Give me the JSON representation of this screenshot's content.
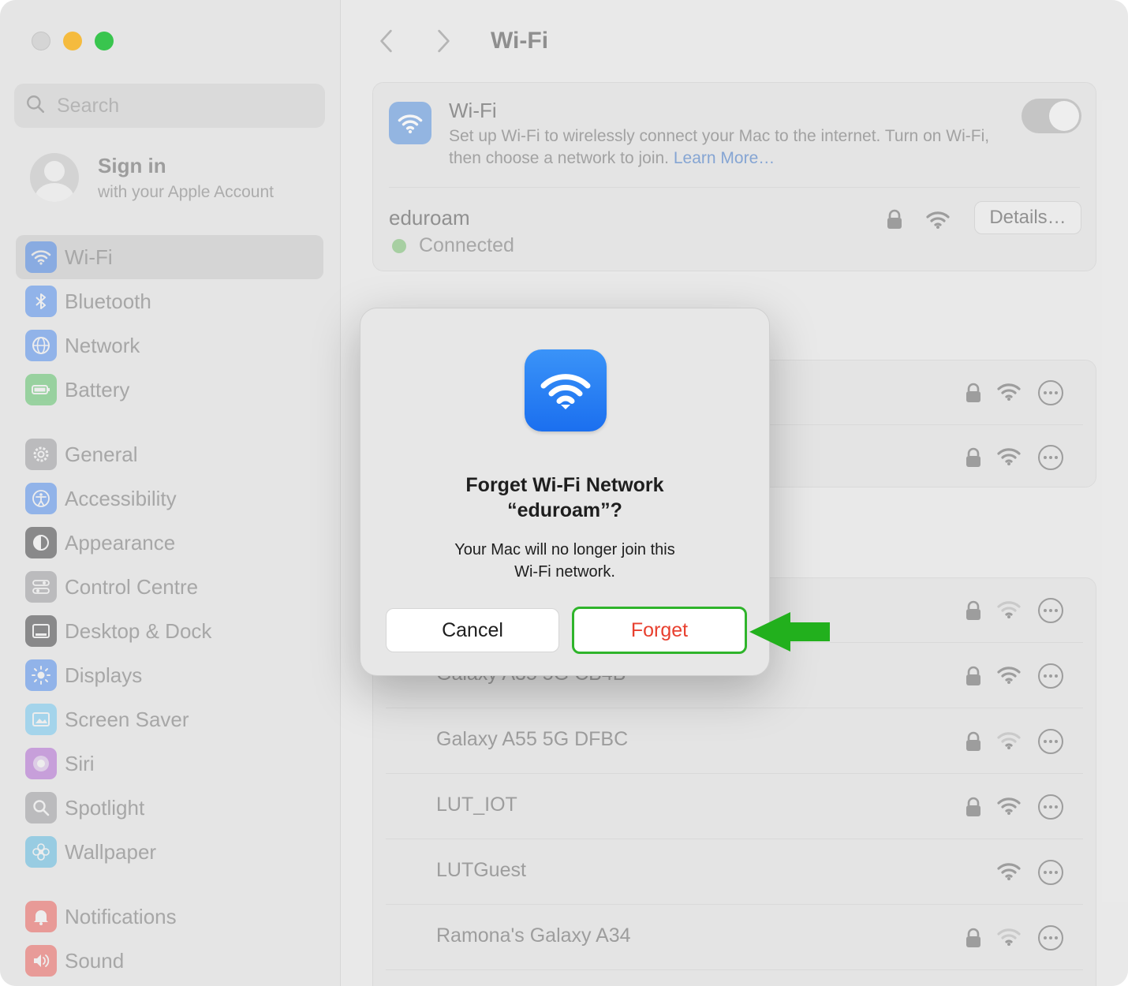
{
  "sidebar": {
    "search_placeholder": "Search",
    "account": {
      "title": "Sign in",
      "subtitle": "with your Apple Account"
    },
    "items": [
      {
        "label": "Wi-Fi",
        "icon": "wifi-icon",
        "color": "#2f7cf6",
        "active": true
      },
      {
        "label": "Bluetooth",
        "icon": "bluetooth-icon",
        "color": "#2f7cf6"
      },
      {
        "label": "Network",
        "icon": "globe-icon",
        "color": "#2f7cf6"
      },
      {
        "label": "Battery",
        "icon": "battery-icon",
        "color": "#3fbf4f"
      },
      {
        "label": "General",
        "icon": "gear-icon",
        "color": "#8e8e93"
      },
      {
        "label": "Accessibility",
        "icon": "accessibility-icon",
        "color": "#2f7cf6"
      },
      {
        "label": "Appearance",
        "icon": "appearance-icon",
        "color": "#1c1c1e"
      },
      {
        "label": "Control Centre",
        "icon": "control-centre-icon",
        "color": "#8e8e93"
      },
      {
        "label": "Desktop & Dock",
        "icon": "dock-icon",
        "color": "#1c1c1e"
      },
      {
        "label": "Displays",
        "icon": "sun-icon",
        "color": "#2f7cf6"
      },
      {
        "label": "Screen Saver",
        "icon": "screen-saver-icon",
        "color": "#5ac8fa"
      },
      {
        "label": "Siri",
        "icon": "siri-icon",
        "color": "#a94fd6"
      },
      {
        "label": "Spotlight",
        "icon": "magnifier-icon",
        "color": "#8e8e93"
      },
      {
        "label": "Wallpaper",
        "icon": "flower-icon",
        "color": "#3fb5e8"
      },
      {
        "label": "Notifications",
        "icon": "bell-icon",
        "color": "#f2453d"
      },
      {
        "label": "Sound",
        "icon": "speaker-icon",
        "color": "#f2453d"
      }
    ]
  },
  "main": {
    "title": "Wi-Fi",
    "wifi": {
      "heading": "Wi-Fi",
      "description": "Set up Wi-Fi to wirelessly connect your Mac to the internet. Turn on Wi-Fi, then choose a network to join.",
      "learn_more": "Learn More…",
      "enabled": true
    },
    "current": {
      "name": "eduroam",
      "status": "Connected",
      "details_label": "Details…"
    },
    "other_networks": [
      {
        "name": "Galaxy A35 5G CB4B",
        "locked": true,
        "signal": "full"
      },
      {
        "name": "Galaxy A55 5G DFBC",
        "locked": true,
        "signal": "weak"
      },
      {
        "name": "LUT_IOT",
        "locked": true,
        "signal": "full"
      },
      {
        "name": "LUTGuest",
        "locked": false,
        "signal": "full"
      },
      {
        "name": "Ramona's Galaxy A34",
        "locked": true,
        "signal": "weak"
      }
    ]
  },
  "dialog": {
    "title_line1": "Forget Wi-Fi Network",
    "title_line2": "“eduroam”?",
    "message_line1": "Your Mac will no longer join this",
    "message_line2": "Wi-Fi network.",
    "cancel_label": "Cancel",
    "forget_label": "Forget",
    "forget_color": "#e8402f",
    "highlight_color": "#2fb42b"
  }
}
